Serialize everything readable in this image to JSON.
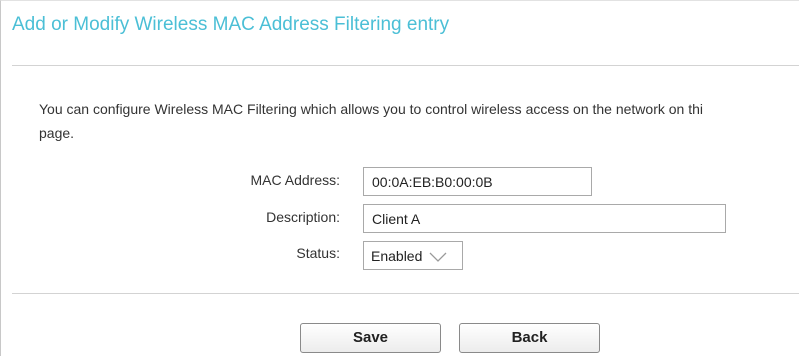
{
  "page": {
    "title": "Add or Modify Wireless MAC Address Filtering entry",
    "intro_line1": "You can configure Wireless MAC Filtering which allows you to control wireless access on the network on thi",
    "intro_line2": "page."
  },
  "form": {
    "mac_label": "MAC Address:",
    "mac_value": "00:0A:EB:B0:00:0B",
    "description_label": "Description:",
    "description_value": "Client A",
    "status_label": "Status:",
    "status_value": "Enabled",
    "status_icon": "chevron-down-icon"
  },
  "buttons": {
    "save_label": "Save",
    "back_label": "Back"
  },
  "colors": {
    "title": "#4bbfd6",
    "text": "#333333",
    "divider": "#d3d3d3"
  }
}
